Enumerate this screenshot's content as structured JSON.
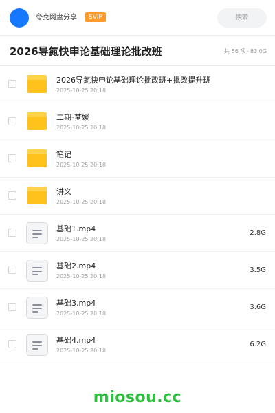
{
  "header": {
    "brand": "夸克网盘分享",
    "badge": "SVIP",
    "search_placeholder": "搜索"
  },
  "folder": {
    "title": "2026导氮快申论基础理论批改班",
    "count": "共 56 项",
    "separator": "·",
    "total_size": "83.0G"
  },
  "items": [
    {
      "type": "folder",
      "name": "2026导氮快申论基础理论批改班+批改提升班",
      "date": "2025-10-25 20:18",
      "size": ""
    },
    {
      "type": "folder",
      "name": "二期-梦媛",
      "date": "2025-10-25 20:18",
      "size": ""
    },
    {
      "type": "folder",
      "name": "笔记",
      "date": "2025-10-25 20:18",
      "size": ""
    },
    {
      "type": "folder",
      "name": "讲义",
      "date": "2025-10-25 20:18",
      "size": ""
    },
    {
      "type": "file",
      "name": "基础1.mp4",
      "date": "2025-10-25 20:18",
      "size": "2.8G"
    },
    {
      "type": "file",
      "name": "基础2.mp4",
      "date": "2025-10-25 20:18",
      "size": "3.5G"
    },
    {
      "type": "file",
      "name": "基础3.mp4",
      "date": "2025-10-25 20:18",
      "size": "3.6G"
    },
    {
      "type": "file",
      "name": "基础4.mp4",
      "date": "2025-10-25 20:18",
      "size": "6.2G"
    }
  ],
  "icons": {
    "folder": "folder-icon",
    "file": "document-icon"
  },
  "colors": {
    "accent": "#1677ff",
    "badge": "#ff9a2e",
    "folder": "#ffc21a",
    "watermark": "#2fbf3f"
  },
  "watermark": "miosou.cc"
}
